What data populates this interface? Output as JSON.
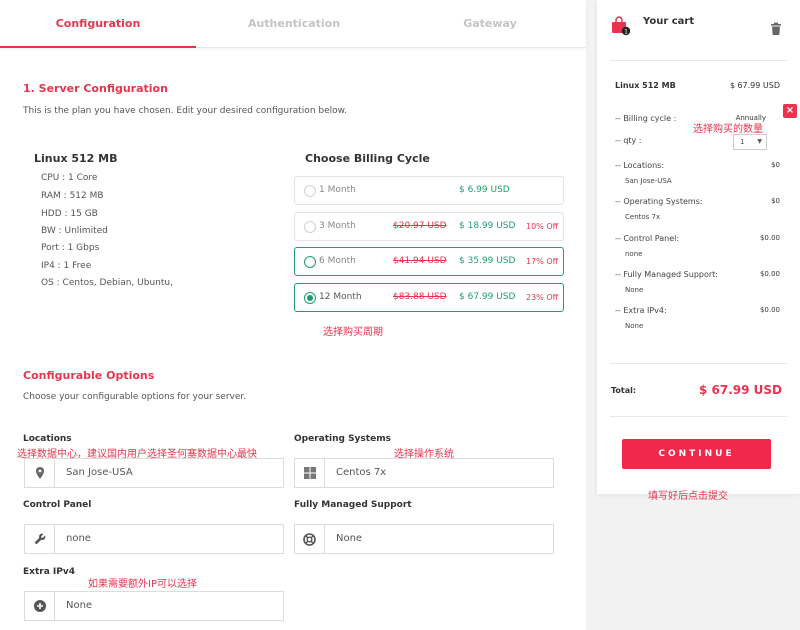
{
  "tabs": [
    "Configuration",
    "Authentication",
    "Gateway"
  ],
  "server_config": {
    "title": "1. Server Configuration",
    "description": "This is the plan you have chosen. Edit your desired configuration below."
  },
  "plan": {
    "name": "Linux 512 MB",
    "specs": [
      "CPU : 1 Core",
      "RAM : 512 MB",
      "HDD : 15 GB",
      "BW : Unlimited",
      "Port : 1 Gbps",
      "IP4 : 1 Free",
      "OS : Centos, Debian, Ubuntu,"
    ]
  },
  "billing": {
    "title": "Choose Billing Cycle",
    "options": [
      {
        "label": "1 Month",
        "old_price": "",
        "price": "$ 6.99 USD",
        "discount": ""
      },
      {
        "label": "3 Month",
        "old_price": "$20.97 USD",
        "price": "$ 18.99 USD",
        "discount": "10% Off"
      },
      {
        "label": "6 Month",
        "old_price": "$41.94 USD",
        "price": "$ 35.99 USD",
        "discount": "17% Off"
      },
      {
        "label": "12 Month",
        "old_price": "$83.88 USD",
        "price": "$ 67.99 USD",
        "discount": "23% Off"
      }
    ],
    "selected": "12 Month"
  },
  "notes": {
    "billing_cycle": "选择购买周期",
    "datacenter": "选择数据中心，建议国内用户选择圣何塞数据中心最快",
    "os": "选择操作系统",
    "ipv4": "如果需要额外IP可以选择",
    "qty": "选择购买的数量",
    "submit": "填写好后点击提交"
  },
  "configurable": {
    "title": "Configurable Options",
    "description": "Choose your configurable options for your server.",
    "fields": {
      "locations": {
        "label": "Locations",
        "value": "San Jose-USA",
        "icon": "map-pin-icon"
      },
      "os": {
        "label": "Operating Systems",
        "value": "Centos 7x",
        "icon": "windows-icon"
      },
      "control_panel": {
        "label": "Control Panel",
        "value": "none",
        "icon": "wrench-icon"
      },
      "managed_support": {
        "label": "Fully Managed Support",
        "value": "None",
        "icon": "lifebuoy-icon"
      },
      "extra_ipv4": {
        "label": "Extra IPv4",
        "value": "None",
        "icon": "plus-circle-icon"
      }
    }
  },
  "cart": {
    "title": "Your cart",
    "badge": "1",
    "product": "Linux 512 MB",
    "product_price": "$ 67.99 USD",
    "billing_cycle_label": "-- Billing cycle :",
    "billing_cycle_value": "Annually",
    "qty_label": "-- qty :",
    "qty_value": "1",
    "items": [
      {
        "label": "-- Locations:",
        "price": "$0",
        "value": "San Jose-USA"
      },
      {
        "label": "-- Operating Systems:",
        "price": "$0",
        "value": "Centos 7x"
      },
      {
        "label": "-- Control Panel:",
        "price": "$0.00",
        "value": "none"
      },
      {
        "label": "-- Fully Managed Support:",
        "price": "$0.00",
        "value": "None"
      },
      {
        "label": "-- Extra IPv4:",
        "price": "$0.00",
        "value": "None"
      }
    ],
    "total_label": "Total:",
    "total_value": "$ 67.99 USD",
    "continue_label": "CONTINUE"
  },
  "colors": {
    "accent": "#e8344e",
    "green": "#1e9e6a",
    "button": "#f0284a"
  }
}
